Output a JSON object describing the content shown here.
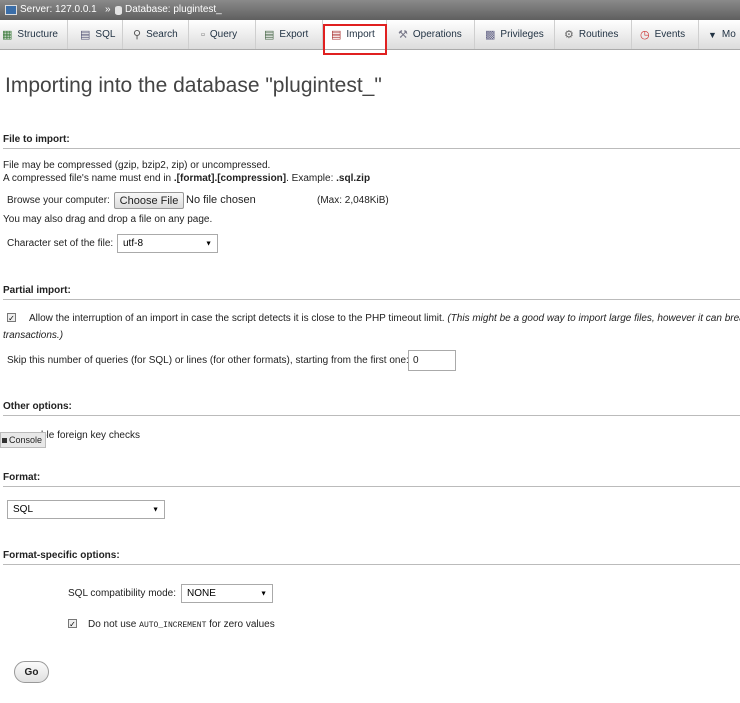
{
  "breadcrumb": {
    "server_label": "Server: 127.0.0.1",
    "separator": "»",
    "database_label": "Database: plugintest_"
  },
  "tabs": [
    {
      "label": "Structure",
      "icon": "structure-icon",
      "active": false
    },
    {
      "label": "SQL",
      "icon": "sql-icon",
      "active": false
    },
    {
      "label": "Search",
      "icon": "search-icon",
      "active": false
    },
    {
      "label": "Query",
      "icon": "query-icon",
      "active": false
    },
    {
      "label": "Export",
      "icon": "export-icon",
      "active": false
    },
    {
      "label": "Import",
      "icon": "import-icon",
      "active": true
    },
    {
      "label": "Operations",
      "icon": "wrench-icon",
      "active": false
    },
    {
      "label": "Privileges",
      "icon": "privileges-icon",
      "active": false
    },
    {
      "label": "Routines",
      "icon": "gears-icon",
      "active": false
    },
    {
      "label": "Events",
      "icon": "clock-icon",
      "active": false
    },
    {
      "label": "Mo",
      "icon": "chevron-down-icon",
      "active": false
    }
  ],
  "highlight_color": "#e02020",
  "page_title": "Importing into the database \"plugintest_\"",
  "file_section": {
    "heading": "File to import:",
    "line1": "File may be compressed (gzip, bzip2, zip) or uncompressed.",
    "line2_prefix": "A compressed file's name must end in ",
    "line2_bold": ".[format].[compression]",
    "line2_mid": ". Example: ",
    "line2_example": ".sql.zip",
    "browse_label": "Browse your computer:",
    "choose_button": "Choose File",
    "no_file": "No file chosen",
    "max_size": "(Max: 2,048KiB)",
    "drag_note": "You may also drag and drop a file on any page.",
    "charset_label": "Character set of the file:",
    "charset_value": "utf-8"
  },
  "partial_section": {
    "heading": "Partial import:",
    "allow_checked": true,
    "allow_text": "Allow the interruption of an import in case the script detects it is close to the PHP timeout limit.",
    "allow_note_1": "(This might be a good way to import large files, however it can break",
    "allow_note_2": "transactions.)",
    "skip_label": "Skip this number of queries (for SQL) or lines (for other formats), starting from the first one:",
    "skip_value": "0"
  },
  "other_section": {
    "heading": "Other options:",
    "fk_text_visible": "ble foreign key checks"
  },
  "console": {
    "label": "Console"
  },
  "format_section": {
    "heading": "Format:",
    "format_value": "SQL"
  },
  "format_specific": {
    "heading": "Format-specific options:",
    "compat_label": "SQL compatibility mode:",
    "compat_value": "NONE",
    "auto_inc_checked": true,
    "auto_inc_prefix": "Do not use ",
    "auto_inc_code": "AUTO_INCREMENT",
    "auto_inc_suffix": " for zero values"
  },
  "go_button": "Go"
}
